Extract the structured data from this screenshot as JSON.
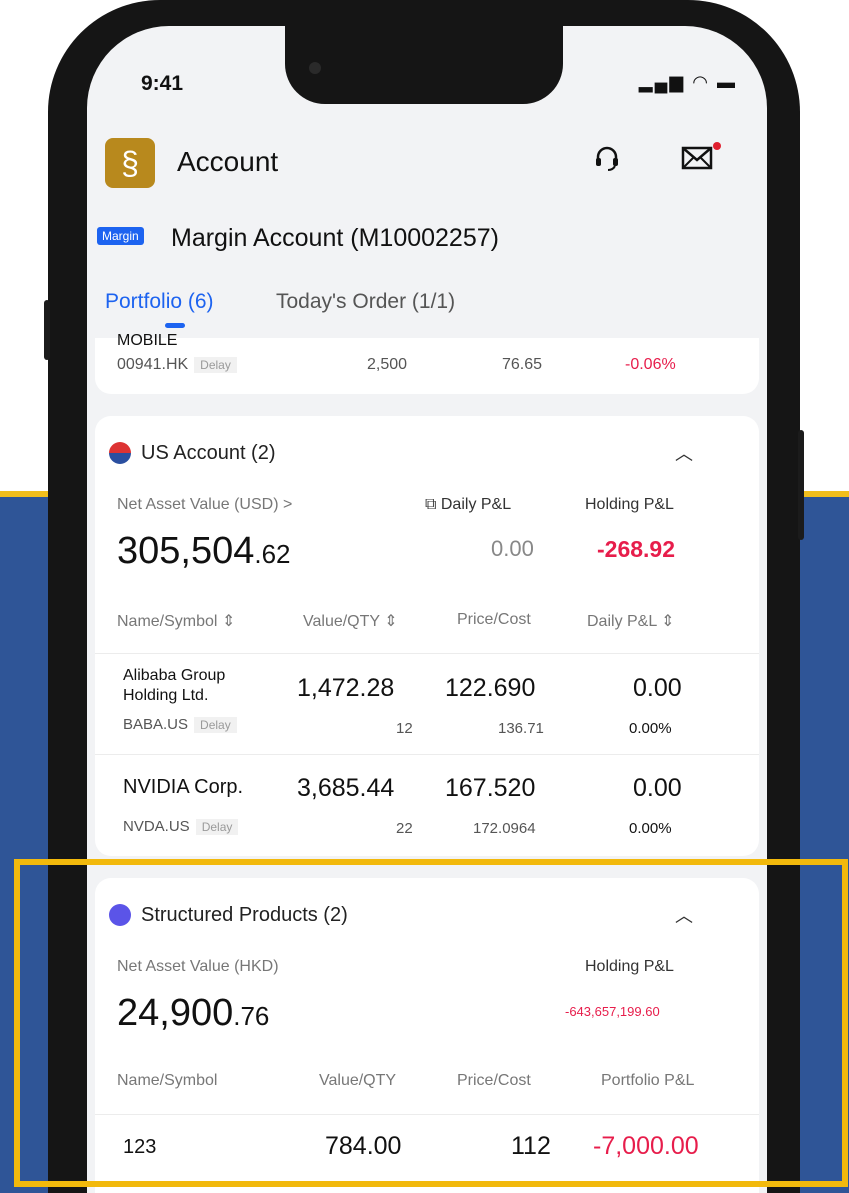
{
  "status_bar": {
    "time": "9:41"
  },
  "header": {
    "title": "Account"
  },
  "account": {
    "badge": "Margin",
    "name": "Margin Account (M10002257)"
  },
  "tabs": {
    "portfolio": "Portfolio (6)",
    "today_order": "Today's Order (1/1)"
  },
  "prev_row": {
    "name": "MOBILE",
    "symbol": "00941.HK",
    "delay": "Delay",
    "qty": "2,500",
    "cost": "76.65",
    "pct": "-0.06%"
  },
  "us_account": {
    "title": "US Account (2)",
    "nav_label": "Net Asset Value (USD) >",
    "daily_label": "Daily P&L",
    "holding_label": "Holding P&L",
    "nav_int": "305,504",
    "nav_dec": ".62",
    "daily_value": "0.00",
    "holding_value": "-268.92",
    "col_name": "Name/Symbol",
    "col_value": "Value/QTY",
    "col_price": "Price/Cost",
    "col_daily": "Daily P&L",
    "rows": [
      {
        "name1": "Alibaba Group",
        "name2": "Holding Ltd.",
        "symbol": "BABA.US",
        "delay": "Delay",
        "value": "1,472.28",
        "qty": "12",
        "price": "122.690",
        "cost": "136.71",
        "pl": "0.00",
        "pct": "0.00%"
      },
      {
        "name1": "NVIDIA Corp.",
        "symbol": "NVDA.US",
        "delay": "Delay",
        "value": "3,685.44",
        "qty": "22",
        "price": "167.520",
        "cost": "172.0964",
        "pl": "0.00",
        "pct": "0.00%"
      }
    ]
  },
  "structured": {
    "title": "Structured Products (2)",
    "nav_label": "Net Asset Value (HKD)",
    "holding_label": "Holding P&L",
    "nav_int": "24,900",
    "nav_dec": ".76",
    "holding_value": "-643,657,199.60",
    "col_name": "Name/Symbol",
    "col_value": "Value/QTY",
    "col_price": "Price/Cost",
    "col_pl": "Portfolio P&L",
    "row": {
      "name": "123",
      "value": "784.00",
      "price": "112",
      "pl": "-7,000.00"
    }
  },
  "colors": {
    "accent": "#1d63f0",
    "negative": "#e71d4b",
    "highlight": "#f2b90c",
    "background_band": "#2f5597"
  }
}
